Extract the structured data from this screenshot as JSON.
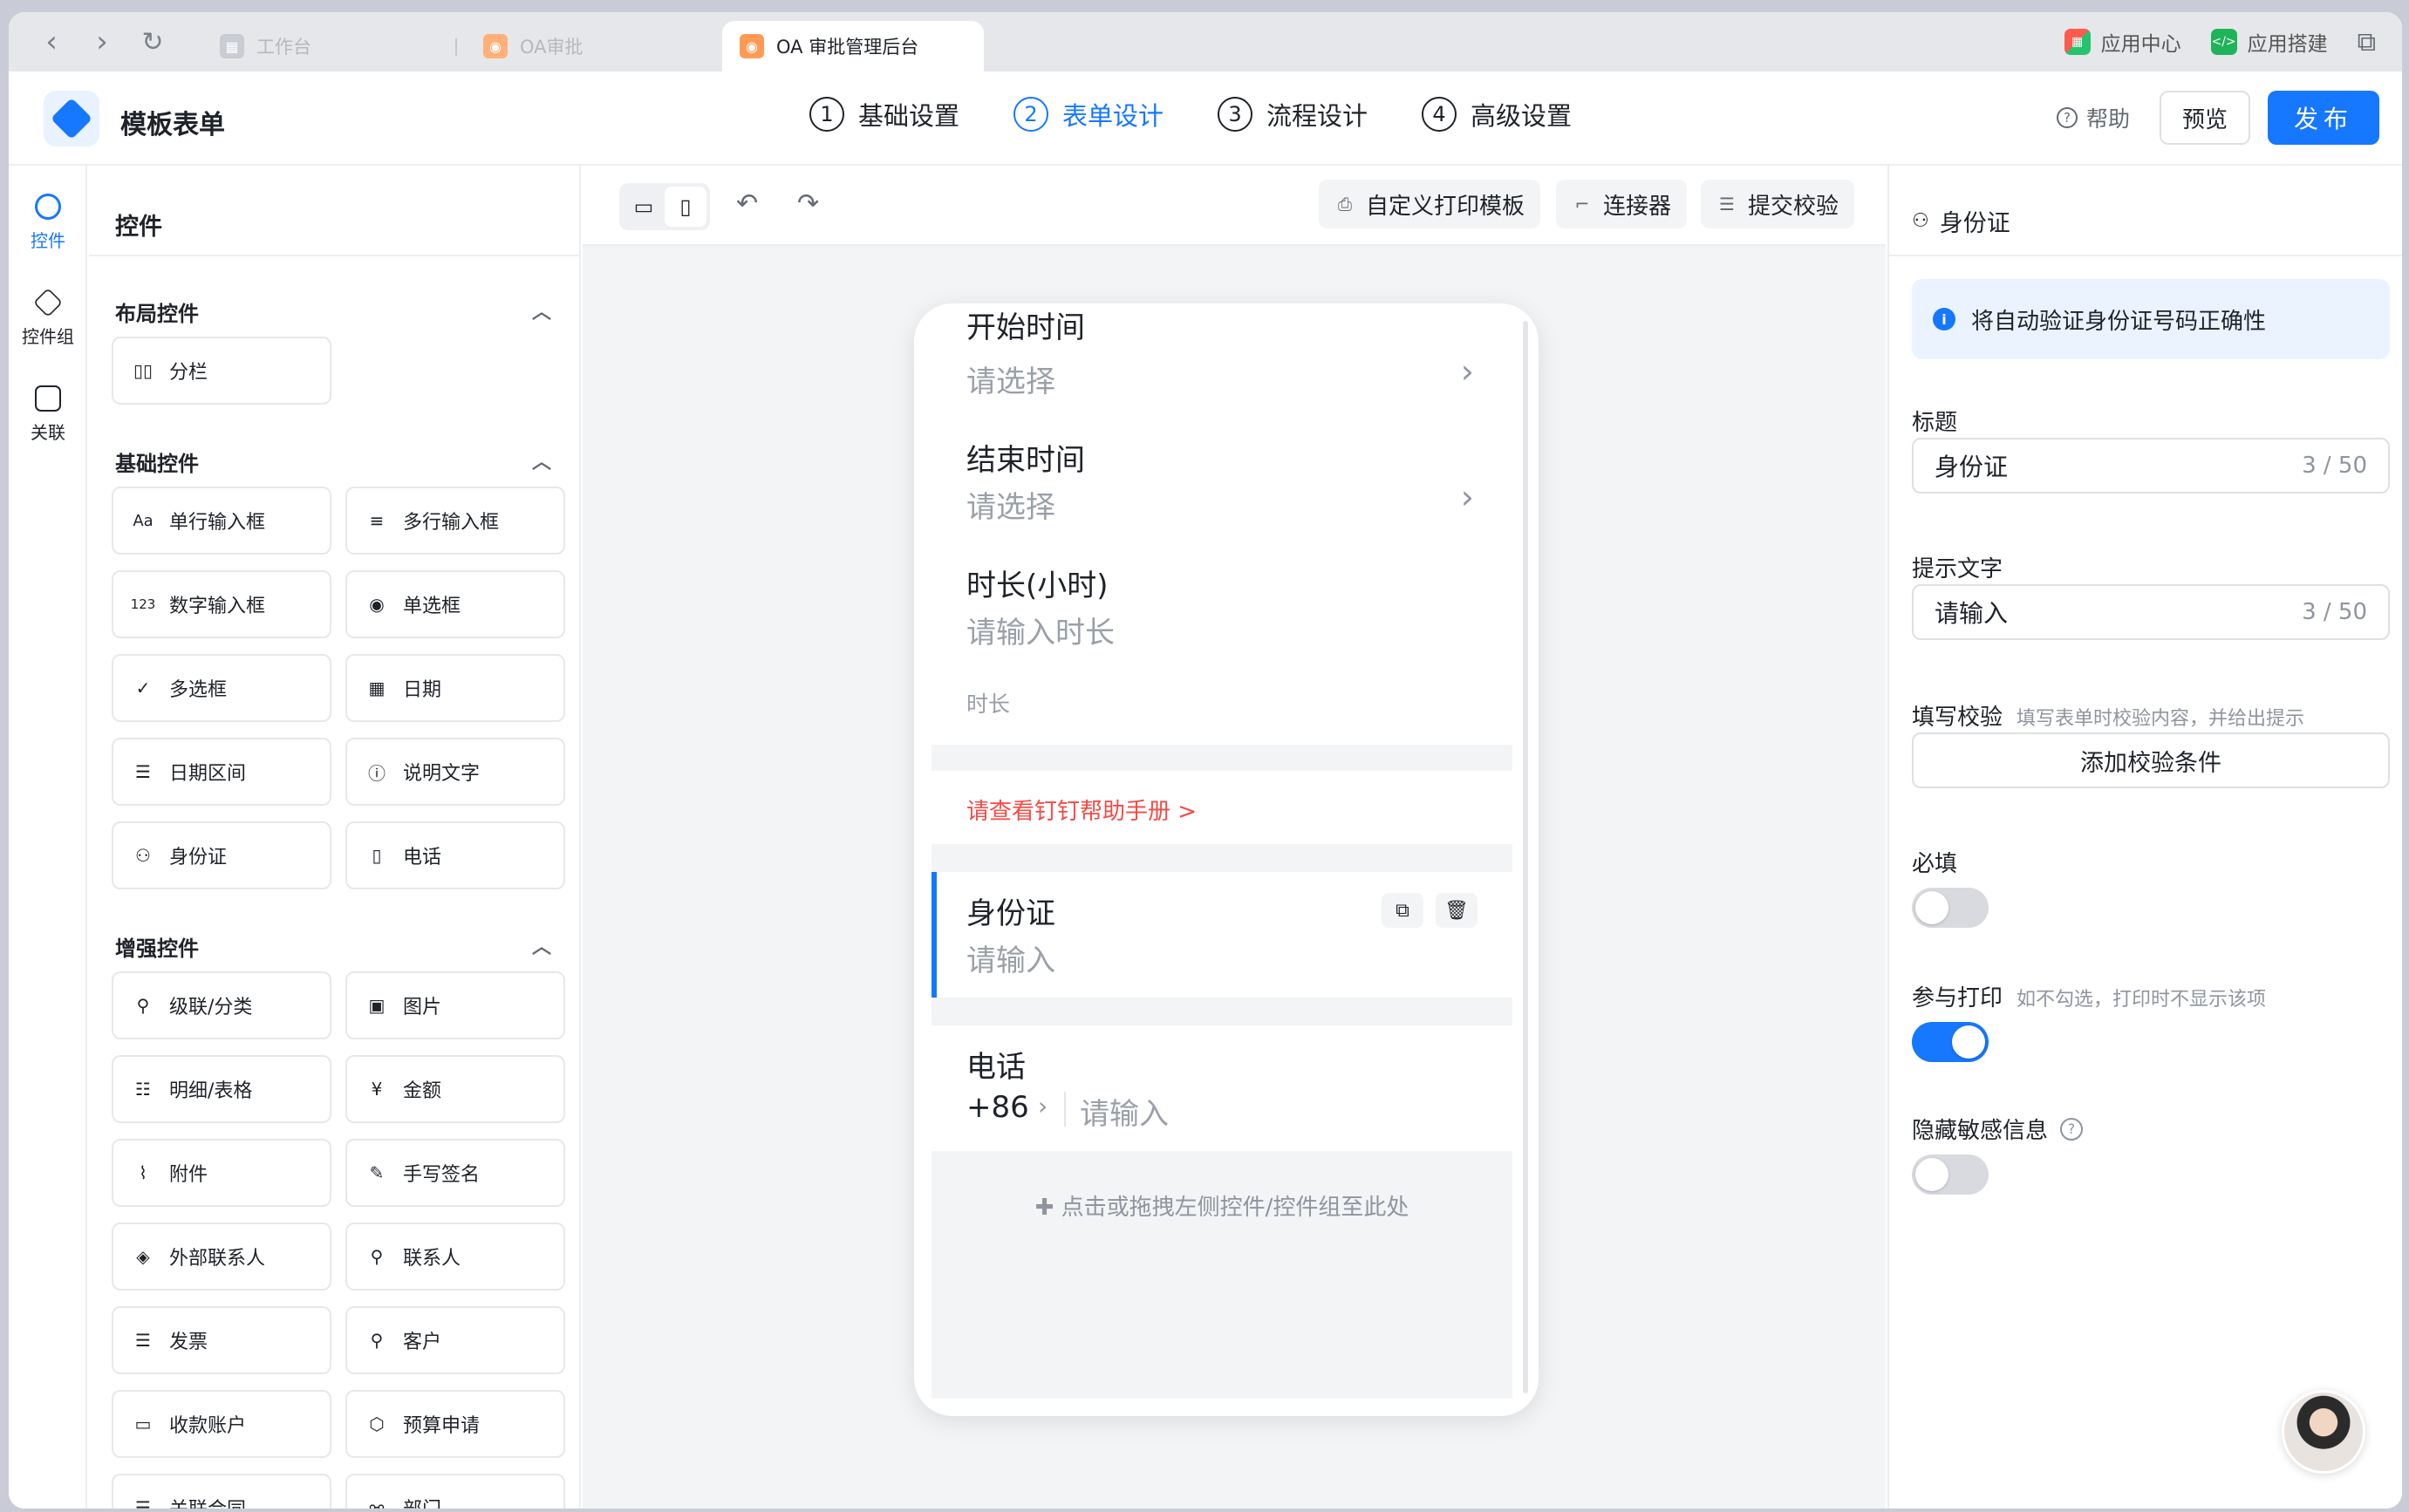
{
  "browser": {
    "tabs": [
      {
        "label": "工作台",
        "active": false
      },
      {
        "label": "OA审批",
        "active": false
      },
      {
        "label": "OA 审批管理后台",
        "active": true
      }
    ],
    "right_apps": [
      {
        "label": "应用中心",
        "icon": "app-center-icon"
      },
      {
        "label": "应用搭建",
        "icon": "app-build-icon"
      }
    ]
  },
  "header": {
    "title": "模板表单",
    "steps": [
      {
        "num": "1",
        "label": "基础设置",
        "active": false
      },
      {
        "num": "2",
        "label": "表单设计",
        "active": true
      },
      {
        "num": "3",
        "label": "流程设计",
        "active": false
      },
      {
        "num": "4",
        "label": "高级设置",
        "active": false
      }
    ],
    "help_label": "帮助",
    "preview_label": "预览",
    "publish_label": "发布"
  },
  "rail": {
    "items": [
      {
        "label": "控件",
        "active": true
      },
      {
        "label": "控件组",
        "active": false
      },
      {
        "label": "关联",
        "active": false
      }
    ]
  },
  "panel": {
    "title": "控件",
    "sections": [
      {
        "title": "布局控件",
        "items": [
          "分栏"
        ]
      },
      {
        "title": "基础控件",
        "items": [
          "单行输入框",
          "多行输入框",
          "数字输入框",
          "单选框",
          "多选框",
          "日期",
          "日期区间",
          "说明文字",
          "身份证",
          "电话"
        ]
      },
      {
        "title": "增强控件",
        "items": [
          "级联/分类",
          "图片",
          "明细/表格",
          "金额",
          "附件",
          "手写签名",
          "外部联系人",
          "联系人",
          "发票",
          "客户",
          "收款账户",
          "预算申请",
          "关联合同",
          "部门"
        ]
      }
    ]
  },
  "canvas": {
    "toolbar": {
      "print_label": "自定义打印模板",
      "connector_label": "连接器",
      "validate_label": "提交校验"
    },
    "form": {
      "start_time_label": "开始时间",
      "start_time_ph": "请选择",
      "end_time_label": "结束时间",
      "end_time_ph": "请选择",
      "duration_label": "时长(小时)",
      "duration_ph": "请输入时长",
      "duration_note": "时长",
      "help_link": "请查看钉钉帮助手册 >",
      "id_label": "身份证",
      "id_ph": "请输入",
      "phone_label": "电话",
      "phone_code": "+86",
      "phone_ph": "请输入",
      "drop_hint": "点击或拖拽左侧控件/控件组至此处"
    }
  },
  "props": {
    "title": "身份证",
    "info": "将自动验证身份证号码正确性",
    "title_label": "标题",
    "title_value": "身份证",
    "title_count": "3 / 50",
    "placeholder_label": "提示文字",
    "placeholder_value": "请输入",
    "placeholder_count": "3 / 50",
    "validate_label": "填写校验",
    "validate_hint": "填写表单时校验内容，并给出提示",
    "add_validate_label": "添加校验条件",
    "required_label": "必填",
    "required_on": false,
    "print_label": "参与打印",
    "print_hint": "如不勾选，打印时不显示该项",
    "print_on": true,
    "sensitive_label": "隐藏敏感信息",
    "sensitive_on": false
  },
  "colors": {
    "accent": "#1677ff",
    "link_red": "#f54a45"
  }
}
